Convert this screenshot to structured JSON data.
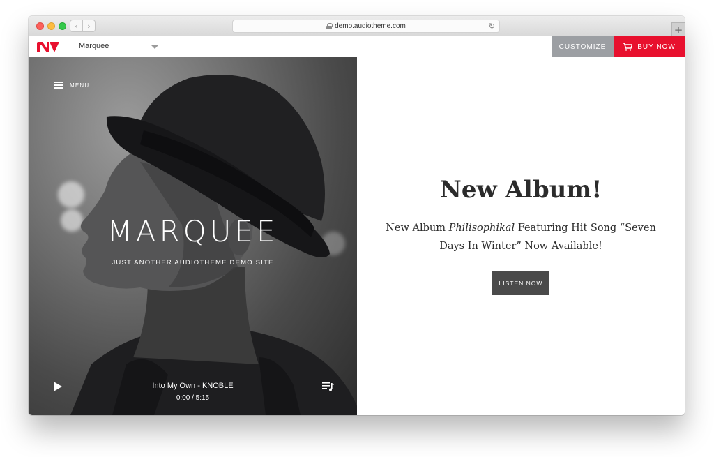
{
  "browser": {
    "url": "demo.audiotheme.com",
    "back_icon": "‹",
    "forward_icon": "›",
    "reload_icon": "↻",
    "newtab_icon": "+"
  },
  "demo_bar": {
    "theme_name": "Marquee",
    "customize_label": "CUSTOMIZE",
    "buy_label": "BUY NOW",
    "colors": {
      "buy": "#e8102e",
      "customize": "#9c9fa3",
      "logo": "#e8102e"
    }
  },
  "hero": {
    "menu_label": "MENU",
    "title": "MARQUEE",
    "tagline": "JUST ANOTHER AUDIOTHEME DEMO SITE",
    "player": {
      "track": "Into My Own - KNOBLE",
      "time": "0:00 / 5:15",
      "play_icon": "play-icon",
      "playlist_icon": "playlist-icon"
    }
  },
  "content": {
    "heading": "New Album!",
    "text_part1": "New Album ",
    "text_em": "Philisophikal",
    "text_part2": " Featuring Hit Song “Seven Days In Winter” Now Available!",
    "button_label": "LISTEN NOW"
  }
}
